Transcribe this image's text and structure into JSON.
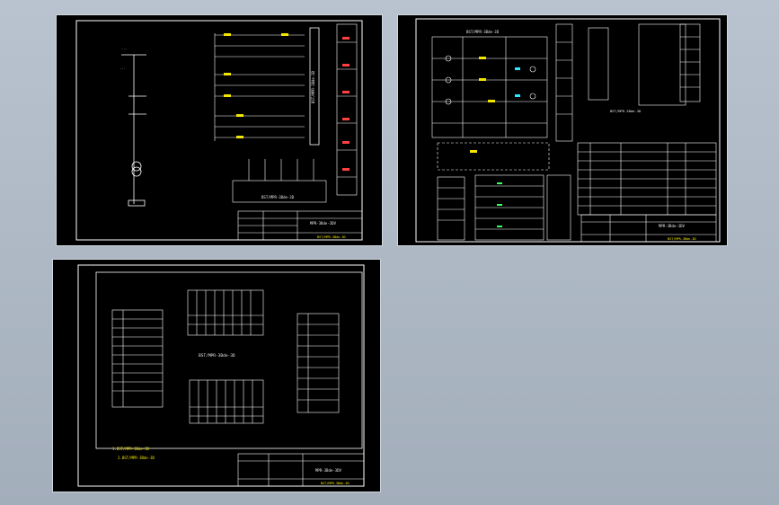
{
  "sheets": [
    {
      "id": "sheet-1",
      "device_label": "BST/MPR-3Bde-3D",
      "title_block_label": "MPR-3Bde-3DV",
      "stamp_label": "BST/MPR-3Bde-3D"
    },
    {
      "id": "sheet-2",
      "device_label": "BST/MPR-3Bde-3D",
      "title_block_label": "MPR-3Bde-3DV",
      "stamp_label": "BST/MPR-3Bde-3D"
    },
    {
      "id": "sheet-3",
      "device_label": "BST/MPR-3Bde-3D",
      "title_block_label": "MPR-3Bde-3DV",
      "stamp_label": "BST/MPR-3Bde-3D",
      "notes": [
        "1.BST/MPR-3Bde-3D",
        "2.BST/MPR-3Bde-3D"
      ]
    }
  ],
  "colors": {
    "line": "#ffffff",
    "accent_yellow": "#f2e600",
    "accent_cyan": "#2ee8ff",
    "accent_red": "#ff4040",
    "accent_green": "#3cff5a"
  }
}
